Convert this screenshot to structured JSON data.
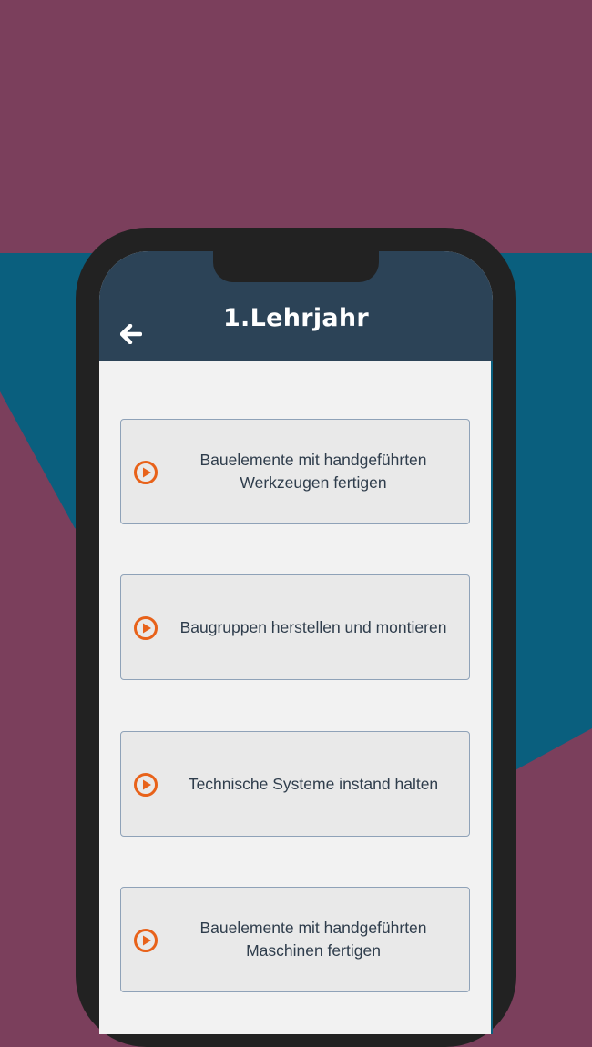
{
  "colors": {
    "background_plum": "#7b3f5c",
    "background_teal": "#0a5f7e",
    "phone_frame": "#222222",
    "header": "#2c4357",
    "card": "#e9e9e9",
    "accent_orange": "#e8621a"
  },
  "header": {
    "title": "1.Lehrjahr",
    "back_icon": "arrow-left-icon"
  },
  "modules": [
    {
      "icon": "play-circle-icon",
      "lines": [
        "Bauelemente mit handgeführten",
        "Werkzeugen fertigen"
      ]
    },
    {
      "icon": "play-circle-icon",
      "lines": [
        "Baugruppen herstellen und montieren"
      ]
    },
    {
      "icon": "play-circle-icon",
      "lines": [
        "Technische Systeme instand halten"
      ]
    },
    {
      "icon": "play-circle-icon",
      "lines": [
        "Bauelemente mit handgeführten",
        "Maschinen fertigen"
      ]
    }
  ]
}
